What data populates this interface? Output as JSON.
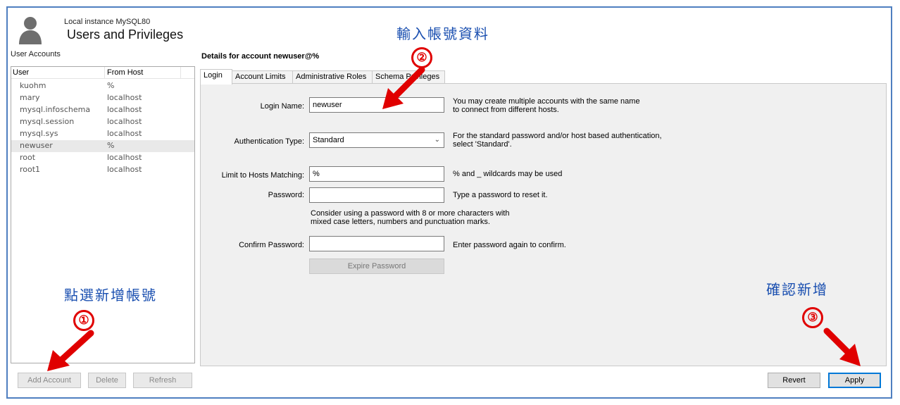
{
  "header": {
    "subtitle": "Local instance MySQL80",
    "title": "Users and Privileges"
  },
  "left_panel": {
    "label": "User Accounts",
    "columns": [
      "User",
      "From Host"
    ],
    "rows": [
      {
        "user": "kuohm",
        "host": "%"
      },
      {
        "user": "mary",
        "host": "localhost"
      },
      {
        "user": "mysql.infoschema",
        "host": "localhost"
      },
      {
        "user": "mysql.session",
        "host": "localhost"
      },
      {
        "user": "mysql.sys",
        "host": "localhost"
      },
      {
        "user": "newuser",
        "host": "%"
      },
      {
        "user": "root",
        "host": "localhost"
      },
      {
        "user": "root1",
        "host": "localhost"
      }
    ],
    "selected_row": "newuser",
    "buttons": {
      "add": "Add Account",
      "delete": "Delete",
      "refresh": "Refresh"
    }
  },
  "details": {
    "label": "Details for account newuser@%",
    "tabs": [
      "Login",
      "Account Limits",
      "Administrative Roles",
      "Schema Privileges"
    ],
    "active_tab": "Login",
    "login_name": {
      "label": "Login Name:",
      "value": "newuser",
      "hint1": "You may create multiple accounts with the same name",
      "hint2": "to connect from different hosts."
    },
    "auth_type": {
      "label": "Authentication Type:",
      "value": "Standard",
      "hint1": "For the standard password and/or host based authentication,",
      "hint2": "select 'Standard'."
    },
    "hosts": {
      "label": "Limit to Hosts Matching:",
      "value": "%",
      "hint": "% and _ wildcards may be used"
    },
    "password": {
      "label": "Password:",
      "value": "",
      "hint": "Type a password to reset it."
    },
    "password_note1": "Consider using a password with 8 or more characters with",
    "password_note2": "mixed case letters, numbers and punctuation marks.",
    "confirm": {
      "label": "Confirm Password:",
      "value": "",
      "hint": "Enter password again to confirm."
    },
    "expire_button": "Expire Password"
  },
  "footer": {
    "revert": "Revert",
    "apply": "Apply"
  },
  "annotations": {
    "enter_info": "輸入帳號資料",
    "click_add": "點選新增帳號",
    "confirm_add": "確認新增",
    "step1": "①",
    "step2": "②",
    "step3": "③",
    "color": "#1a4fb0",
    "arrow_color": "#e00000"
  },
  "colors": {
    "frame_border": "#4f7fc0",
    "selected_row": "#e9e9e9",
    "content_bg": "#f0f0f0"
  }
}
